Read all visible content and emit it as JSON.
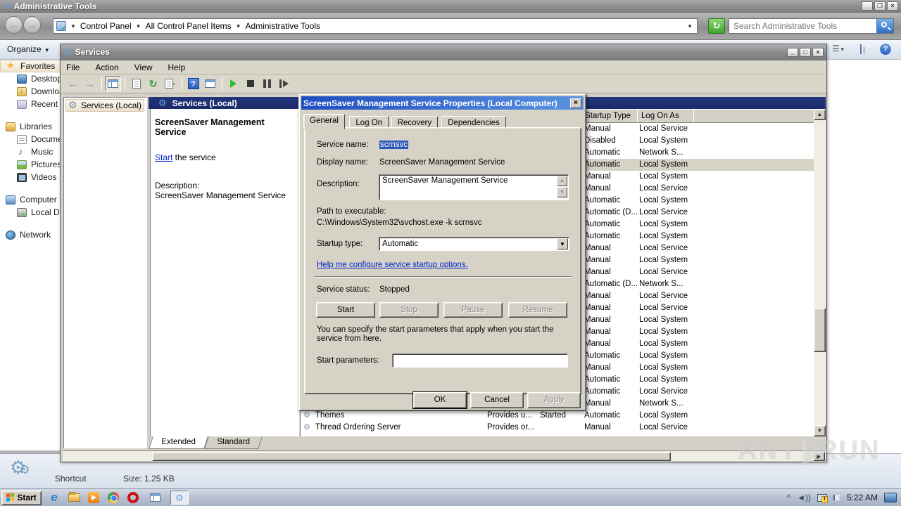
{
  "explorer": {
    "title": "Administrative Tools",
    "window_controls": {
      "minimize": "_",
      "restore": "❐",
      "close": "×"
    },
    "breadcrumb": [
      "Control Panel",
      "All Control Panel Items",
      "Administrative Tools"
    ],
    "search_placeholder": "Search Administrative Tools",
    "organize_label": "Organize",
    "sidebar": [
      {
        "label": "Favorites",
        "icon": "star",
        "child": false,
        "highlight": true
      },
      {
        "label": "Desktop",
        "icon": "desktop",
        "child": true
      },
      {
        "label": "Downloads",
        "icon": "folderdl",
        "child": true
      },
      {
        "label": "Recent Places",
        "icon": "recent",
        "child": true
      },
      {
        "gap": true
      },
      {
        "label": "Libraries",
        "icon": "lib",
        "child": false
      },
      {
        "label": "Documents",
        "icon": "doc",
        "child": true
      },
      {
        "label": "Music",
        "icon": "music",
        "child": true
      },
      {
        "label": "Pictures",
        "icon": "pic",
        "child": true
      },
      {
        "label": "Videos",
        "icon": "video",
        "child": true
      },
      {
        "gap": true
      },
      {
        "label": "Computer",
        "icon": "computer",
        "child": false
      },
      {
        "label": "Local Disk",
        "icon": "disk",
        "child": true
      },
      {
        "gap": true
      },
      {
        "label": "Network",
        "icon": "network",
        "child": false
      }
    ],
    "details": {
      "type": "Shortcut",
      "size": "Size: 1.25 KB"
    }
  },
  "services_window": {
    "title": "Services",
    "menus": [
      "File",
      "Action",
      "View",
      "Help"
    ],
    "tree_item": "Services (Local)",
    "banner": "Services (Local)",
    "info_panel": {
      "service_title": "ScreenSaver Management Service",
      "start_link": "Start",
      "start_rest": " the service",
      "description_label": "Description:",
      "description": "ScreenSaver Management Service"
    },
    "list": {
      "columns": {
        "startup": "Startup Type",
        "logon": "Log On As"
      },
      "rows": [
        {
          "name": "",
          "desc": "",
          "status": "",
          "startup": "Manual",
          "logon": "Local Service"
        },
        {
          "name": "",
          "desc": "",
          "status": "",
          "startup": "Disabled",
          "logon": "Local System"
        },
        {
          "name": "",
          "desc": "",
          "status": "",
          "startup": "Automatic",
          "logon": "Network S..."
        },
        {
          "name": "",
          "desc": "",
          "status": "",
          "startup": "Automatic",
          "logon": "Local System",
          "selected": true
        },
        {
          "name": "",
          "desc": "",
          "status": "",
          "startup": "Manual",
          "logon": "Local System"
        },
        {
          "name": "",
          "desc": "",
          "status": "",
          "startup": "Manual",
          "logon": "Local Service"
        },
        {
          "name": "",
          "desc": "",
          "status": "",
          "startup": "Automatic",
          "logon": "Local System"
        },
        {
          "name": "",
          "desc": "",
          "status": "",
          "startup": "Automatic (D...",
          "logon": "Local Service"
        },
        {
          "name": "",
          "desc": "",
          "status": "",
          "startup": "Automatic",
          "logon": "Local System"
        },
        {
          "name": "",
          "desc": "",
          "status": "",
          "startup": "Automatic",
          "logon": "Local System"
        },
        {
          "name": "",
          "desc": "",
          "status": "",
          "startup": "Manual",
          "logon": "Local Service"
        },
        {
          "name": "",
          "desc": "",
          "status": "",
          "startup": "Manual",
          "logon": "Local System"
        },
        {
          "name": "",
          "desc": "",
          "status": "",
          "startup": "Manual",
          "logon": "Local Service"
        },
        {
          "name": "",
          "desc": "",
          "status": "",
          "startup": "Automatic (D...",
          "logon": "Network S..."
        },
        {
          "name": "",
          "desc": "",
          "status": "",
          "startup": "Manual",
          "logon": "Local Service"
        },
        {
          "name": "",
          "desc": "",
          "status": "",
          "startup": "Manual",
          "logon": "Local Service"
        },
        {
          "name": "",
          "desc": "",
          "status": "",
          "startup": "Manual",
          "logon": "Local System"
        },
        {
          "name": "",
          "desc": "",
          "status": "",
          "startup": "Manual",
          "logon": "Local System"
        },
        {
          "name": "",
          "desc": "",
          "status": "",
          "startup": "Manual",
          "logon": "Local System"
        },
        {
          "name": "",
          "desc": "",
          "status": "",
          "startup": "Automatic",
          "logon": "Local System"
        },
        {
          "name": "",
          "desc": "",
          "status": "",
          "startup": "Manual",
          "logon": "Local System"
        },
        {
          "name": "",
          "desc": "",
          "status": "",
          "startup": "Automatic",
          "logon": "Local System"
        },
        {
          "name": "",
          "desc": "",
          "status": "",
          "startup": "Automatic",
          "logon": "Local Service"
        },
        {
          "name": "",
          "desc": "",
          "status": "",
          "startup": "Manual",
          "logon": "Network S..."
        },
        {
          "name": "Themes",
          "desc": "Provides u...",
          "status": "Started",
          "startup": "Automatic",
          "logon": "Local System"
        },
        {
          "name": "Thread Ordering Server",
          "desc": "Provides or...",
          "status": "",
          "startup": "Manual",
          "logon": "Local Service"
        }
      ]
    },
    "view_tabs": [
      {
        "label": "Extended",
        "active": true
      },
      {
        "label": "Standard",
        "active": false
      }
    ]
  },
  "dialog": {
    "title": "ScreenSaver Management Service Properties (Local Computer)",
    "close": "×",
    "tabs": [
      {
        "label": "General",
        "active": true
      },
      {
        "label": "Log On",
        "active": false
      },
      {
        "label": "Recovery",
        "active": false
      },
      {
        "label": "Dependencies",
        "active": false
      }
    ],
    "fields": {
      "service_name_label": "Service name:",
      "service_name": "scrnsvc",
      "display_name_label": "Display name:",
      "display_name": "ScreenSaver Management Service",
      "description_label": "Description:",
      "description": "ScreenSaver Management Service",
      "path_label": "Path to executable:",
      "path": "C:\\Windows\\System32\\svchost.exe -k scrnsvc",
      "startup_label": "Startup type:",
      "startup_value": "Automatic",
      "help_link": "Help me configure service startup options.",
      "status_label": "Service status:",
      "status_value": "Stopped",
      "params_note": "You can specify the start parameters that apply when you start the service from here.",
      "params_label": "Start parameters:",
      "params_value": ""
    },
    "buttons": {
      "start": "Start",
      "stop": "Stop",
      "pause": "Pause",
      "resume": "Resume",
      "ok": "OK",
      "cancel": "Cancel",
      "apply": "Apply"
    }
  },
  "taskbar": {
    "start_label": "Start",
    "clock": "5:22 AM",
    "tray_chevron": "^"
  },
  "watermark": {
    "left": "ANY",
    "right": "RUN"
  }
}
